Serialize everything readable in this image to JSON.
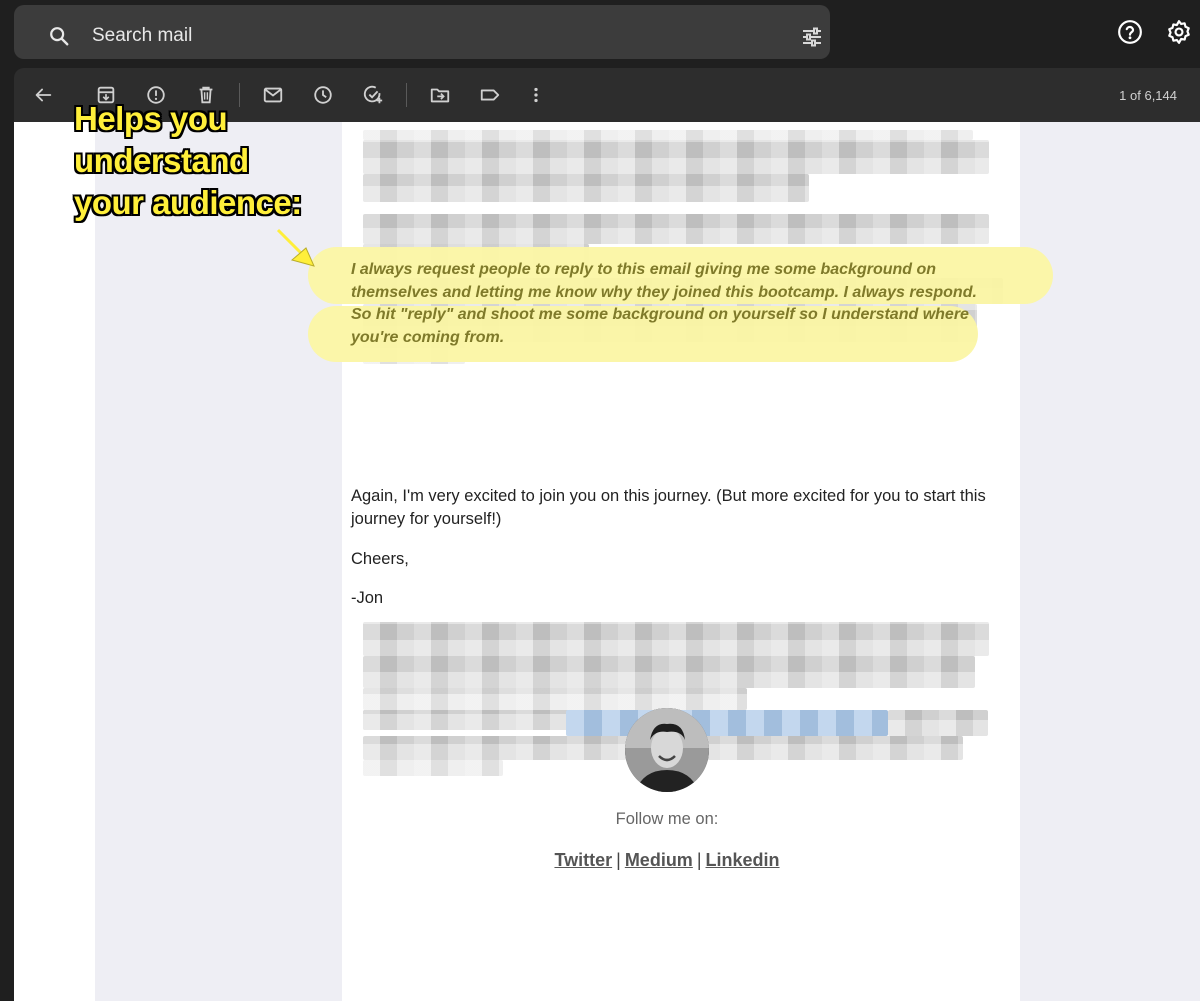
{
  "search": {
    "placeholder": "Search mail"
  },
  "toolbar": {
    "pager": "1 of 6,144"
  },
  "annotation": {
    "lines": [
      "Helps you",
      "understand",
      "your audience:"
    ]
  },
  "email": {
    "highlight_paragraph": "I always request people to reply to this email giving me some background on themselves and letting me know why they joined this bootcamp. I always respond. So hit \"reply\" and shoot me some background on yourself so I understand where you're coming from.",
    "paragraph": "Again, I'm very excited to join you on this journey. (But more excited for you to start this journey for yourself!)",
    "closing": "Cheers,",
    "signature": "-Jon",
    "follow_label": "Follow me on:",
    "links": {
      "twitter": "Twitter",
      "medium": "Medium",
      "linkedin": "Linkedin",
      "separator": "|"
    }
  },
  "colors": {
    "highlight": "#fbf5a4",
    "annotation_text": "#ffef3a",
    "highlight_text": "#7f7a2a"
  },
  "icons": [
    "search-icon",
    "tune-icon",
    "help-icon",
    "settings-icon",
    "back-icon",
    "archive-icon",
    "report-spam-icon",
    "delete-icon",
    "mark-unread-icon",
    "snooze-icon",
    "add-to-tasks-icon",
    "move-to-icon",
    "label-icon",
    "more-icon"
  ]
}
